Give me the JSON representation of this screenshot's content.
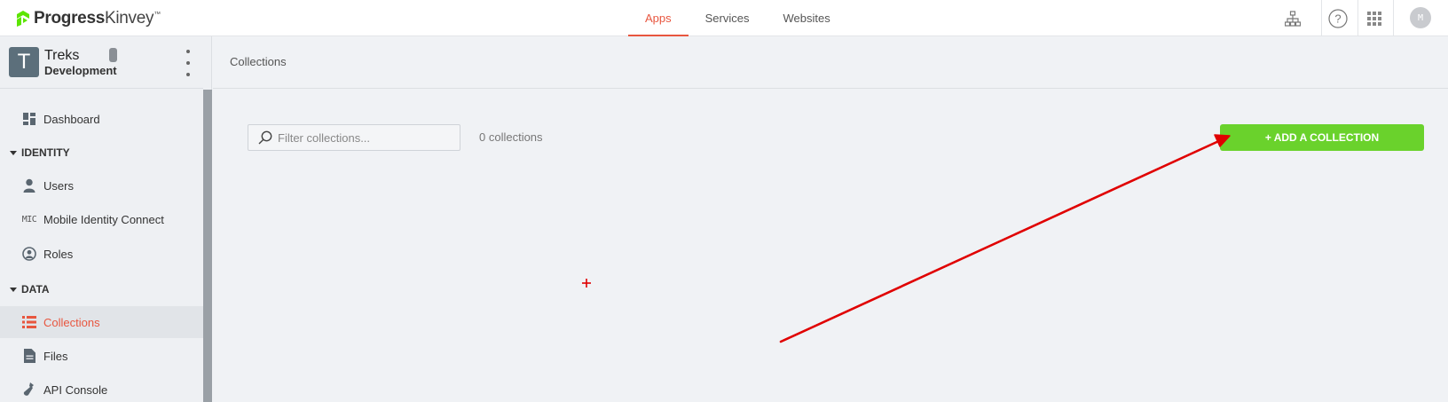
{
  "brand": {
    "name_bold": "Progress",
    "name_light": "Kinvey",
    "trademark": "™",
    "color": "#5ce500"
  },
  "topnav": {
    "items": [
      {
        "label": "Apps",
        "active": true
      },
      {
        "label": "Services",
        "active": false
      },
      {
        "label": "Websites",
        "active": false
      }
    ],
    "icons": [
      "sitemap-icon",
      "help-icon",
      "app-grid-icon"
    ],
    "avatar_initial": "M"
  },
  "sidebar": {
    "app": {
      "initial": "T",
      "name": "Treks",
      "environment": "Development"
    },
    "items": [
      {
        "kind": "item",
        "label": "Dashboard",
        "icon": "dashboard-icon"
      },
      {
        "kind": "section",
        "label": "IDENTITY"
      },
      {
        "kind": "item",
        "label": "Users",
        "icon": "user-icon"
      },
      {
        "kind": "item",
        "label": "Mobile Identity Connect",
        "icon": "mic-icon",
        "icon_text": "MIC"
      },
      {
        "kind": "item",
        "label": "Roles",
        "icon": "roles-icon"
      },
      {
        "kind": "section",
        "label": "DATA"
      },
      {
        "kind": "item",
        "label": "Collections",
        "icon": "list-icon",
        "active": true
      },
      {
        "kind": "item",
        "label": "Files",
        "icon": "file-icon"
      },
      {
        "kind": "item",
        "label": "API Console",
        "icon": "flask-icon"
      }
    ]
  },
  "main": {
    "breadcrumb": "Collections",
    "filter": {
      "placeholder": "Filter collections...",
      "value": ""
    },
    "count_text": "0 collections",
    "add_button": "+ ADD A COLLECTION"
  },
  "colors": {
    "accent": "#e8563f",
    "add_button": "#6ad22c",
    "annotation": "#e00000"
  }
}
